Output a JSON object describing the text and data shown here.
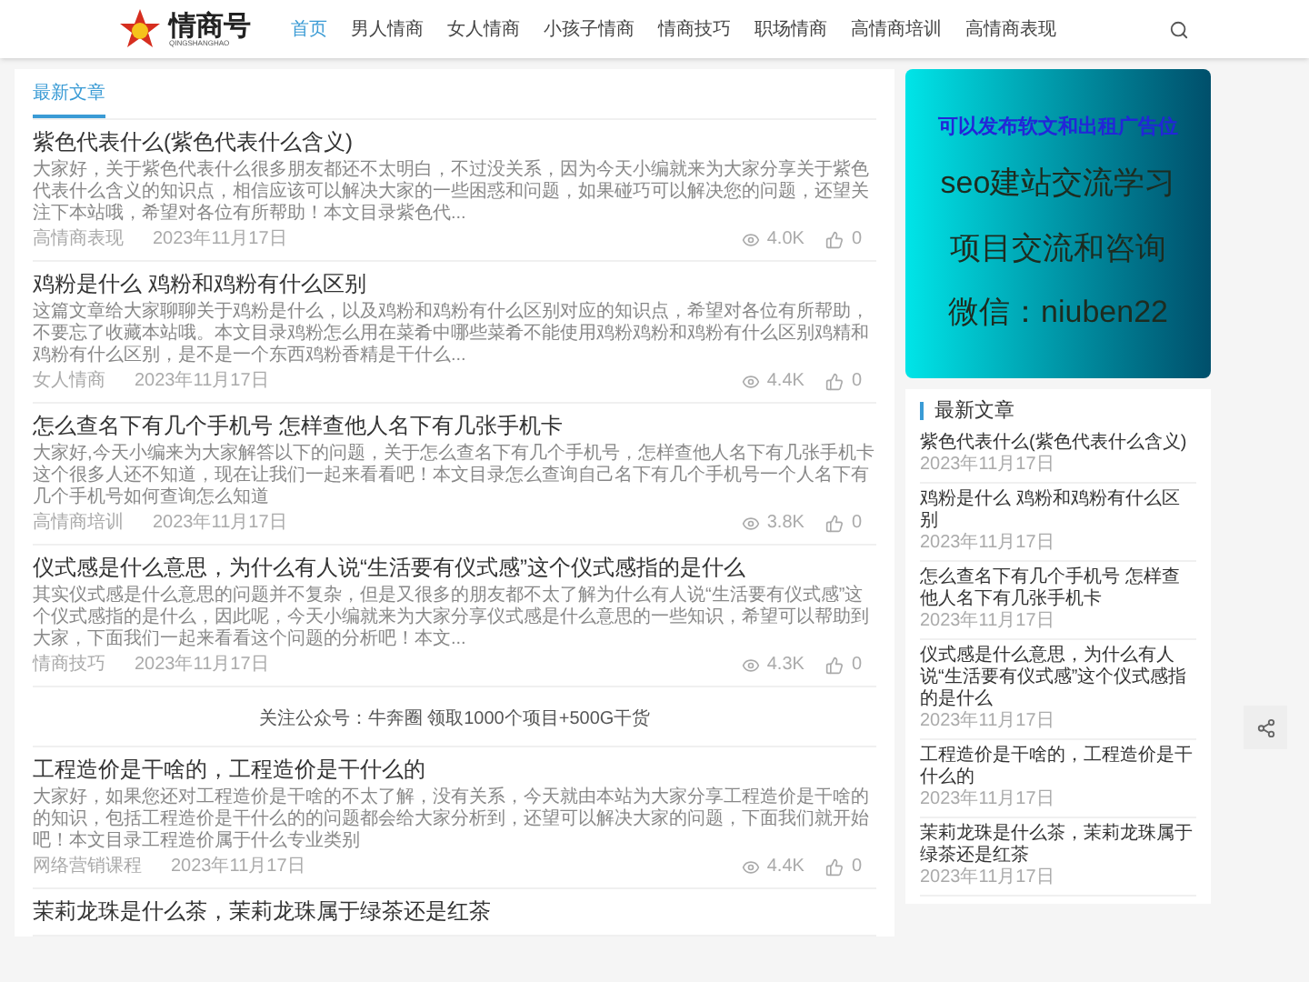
{
  "header": {
    "logo_text": "情商号",
    "logo_subtext": "QINGSHANGHAO",
    "nav": [
      {
        "label": "首页",
        "selected": true
      },
      {
        "label": "男人情商",
        "selected": false
      },
      {
        "label": "女人情商",
        "selected": false
      },
      {
        "label": "小孩子情商",
        "selected": false
      },
      {
        "label": "情商技巧",
        "selected": false
      },
      {
        "label": "职场情商",
        "selected": false
      },
      {
        "label": "高情商培训",
        "selected": false
      },
      {
        "label": "高情商表现",
        "selected": false
      }
    ]
  },
  "main": {
    "section_title": "最新文章",
    "items": [
      {
        "kind": "article",
        "title": "紫色代表什么(紫色代表什么含义)",
        "excerpt": "大家好，关于紫色代表什么很多朋友都还不太明白，不过没关系，因为今天小编就来为大家分享关于紫色代表什么含义的知识点，相信应该可以解决大家的一些困惑和问题，如果碰巧可以解决您的问题，还望关注下本站哦，希望对各位有所帮助！本文目录紫色代...",
        "category": "高情商表现",
        "date": "2023年11月17日",
        "views": "4.0K",
        "likes": "0"
      },
      {
        "kind": "article",
        "title": "鸡粉是什么 鸡粉和鸡粉有什么区别",
        "excerpt": "这篇文章给大家聊聊关于鸡粉是什么，以及鸡粉和鸡粉有什么区别对应的知识点，希望对各位有所帮助，不要忘了收藏本站哦。本文目录鸡粉怎么用在菜肴中哪些菜肴不能使用鸡粉鸡粉和鸡粉有什么区别鸡精和鸡粉有什么区别，是不是一个东西鸡粉香精是干什么...",
        "category": "女人情商",
        "date": "2023年11月17日",
        "views": "4.4K",
        "likes": "0"
      },
      {
        "kind": "article",
        "title": "怎么查名下有几个手机号 怎样查他人名下有几张手机卡",
        "excerpt": "大家好,今天小编来为大家解答以下的问题，关于怎么查名下有几个手机号，怎样查他人名下有几张手机卡这个很多人还不知道，现在让我们一起来看看吧！本文目录怎么查询自己名下有几个手机号一个人名下有几个手机号如何查询怎么知道",
        "category": "高情商培训",
        "date": "2023年11月17日",
        "views": "3.8K",
        "likes": "0"
      },
      {
        "kind": "article",
        "title": "仪式感是什么意思，为什么有人说“生活要有仪式感”这个仪式感指的是什么",
        "excerpt": "其实仪式感是什么意思的问题并不复杂，但是又很多的朋友都不太了解为什么有人说“生活要有仪式感”这个仪式感指的是什么，因此呢，今天小编就来为大家分享仪式感是什么意思的一些知识，希望可以帮助到大家，下面我们一起来看看这个问题的分析吧！本文...",
        "category": "情商技巧",
        "date": "2023年11月17日",
        "views": "4.3K",
        "likes": "0"
      },
      {
        "kind": "promo",
        "text": "关注公众号：牛奔圈 领取1000个项目+500G干货"
      },
      {
        "kind": "article",
        "title": "工程造价是干啥的，工程造价是干什么的",
        "excerpt": "大家好，如果您还对工程造价是干啥的不太了解，没有关系，今天就由本站为大家分享工程造价是干啥的的知识，包括工程造价是干什么的的问题都会给大家分析到，还望可以解决大家的问题，下面我们就开始吧！本文目录工程造价属于什么专业类别",
        "category": "网络营销课程",
        "date": "2023年11月17日",
        "views": "4.4K",
        "likes": "0"
      },
      {
        "kind": "article",
        "title": "茉莉龙珠是什么茶，茉莉龙珠属于绿茶还是红茶"
      }
    ]
  },
  "sidebar": {
    "ad_lines": [
      "可以发布软文和出租广告位",
      "seo建站交流学习",
      "项目交流和咨询",
      "微信：niuben22"
    ],
    "recent_title": "最新文章",
    "recent": [
      {
        "title": "紫色代表什么(紫色代表什么含义)",
        "date": "2023年11月17日"
      },
      {
        "title": "鸡粉是什么 鸡粉和鸡粉有什么区别",
        "date": "2023年11月17日"
      },
      {
        "title": "怎么查名下有几个手机号 怎样查他人名下有几张手机卡",
        "date": "2023年11月17日"
      },
      {
        "title": "仪式感是什么意思，为什么有人说“生活要有仪式感”这个仪式感指的是什么",
        "date": "2023年11月17日"
      },
      {
        "title": "工程造价是干啥的，工程造价是干什么的",
        "date": "2023年11月17日"
      },
      {
        "title": "茉莉龙珠是什么茶，茉莉龙珠属于绿茶还是红茶",
        "date": "2023年11月17日"
      }
    ]
  }
}
